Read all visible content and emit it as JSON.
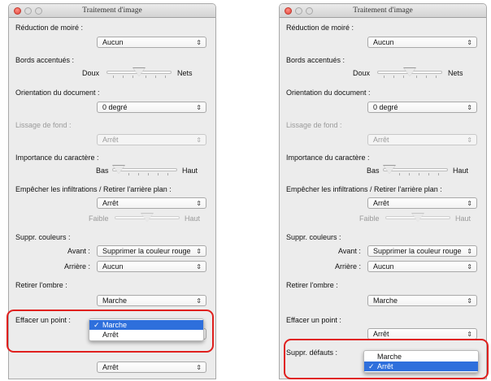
{
  "title": "Traitement d'image",
  "colors": {
    "highlight": "#e0201e",
    "selection": "#2e6fdc"
  },
  "labels": {
    "moire": "Réduction de moiré :",
    "bords": "Bords accentués :",
    "doux": "Doux",
    "nets": "Nets",
    "orientation": "Orientation du document :",
    "lissage": "Lissage de fond :",
    "importance": "Importance du caractère :",
    "bas": "Bas",
    "haut": "Haut",
    "infiltrations": "Empêcher les infiltrations / Retirer l'arrière plan :",
    "faible": "Faible",
    "suppr_couleurs": "Suppr. couleurs :",
    "avant": "Avant :",
    "arriere": "Arrière :",
    "ombre": "Retirer l'ombre :",
    "effacer": "Effacer un point :",
    "defauts": "Suppr. défauts :",
    "defauts_partial": "Suppr. défauts :"
  },
  "values": {
    "moire": "Aucun",
    "orientation": "0 degré",
    "lissage": "Arrêt",
    "infiltrations": "Arrêt",
    "avant": "Supprimer la couleur rouge",
    "arriere": "Aucun",
    "ombre": "Marche",
    "effacer": "Arrêt",
    "defauts": "Arrêt"
  },
  "menus": {
    "left": [
      {
        "label": "Marche",
        "checked": true
      },
      {
        "label": "Arrêt",
        "checked": false
      }
    ],
    "right": [
      {
        "label": "Marche",
        "checked": false
      },
      {
        "label": "Arrêt",
        "checked": true
      }
    ]
  },
  "sliders": {
    "bords": 0.5,
    "importance": 0.0,
    "infiltration_level": 0.5
  },
  "icons": {
    "arrows": "up-down-arrows-icon",
    "check": "checkmark-icon"
  },
  "glyphs": {
    "arrows": "⌃⌄",
    "check": "✓"
  }
}
